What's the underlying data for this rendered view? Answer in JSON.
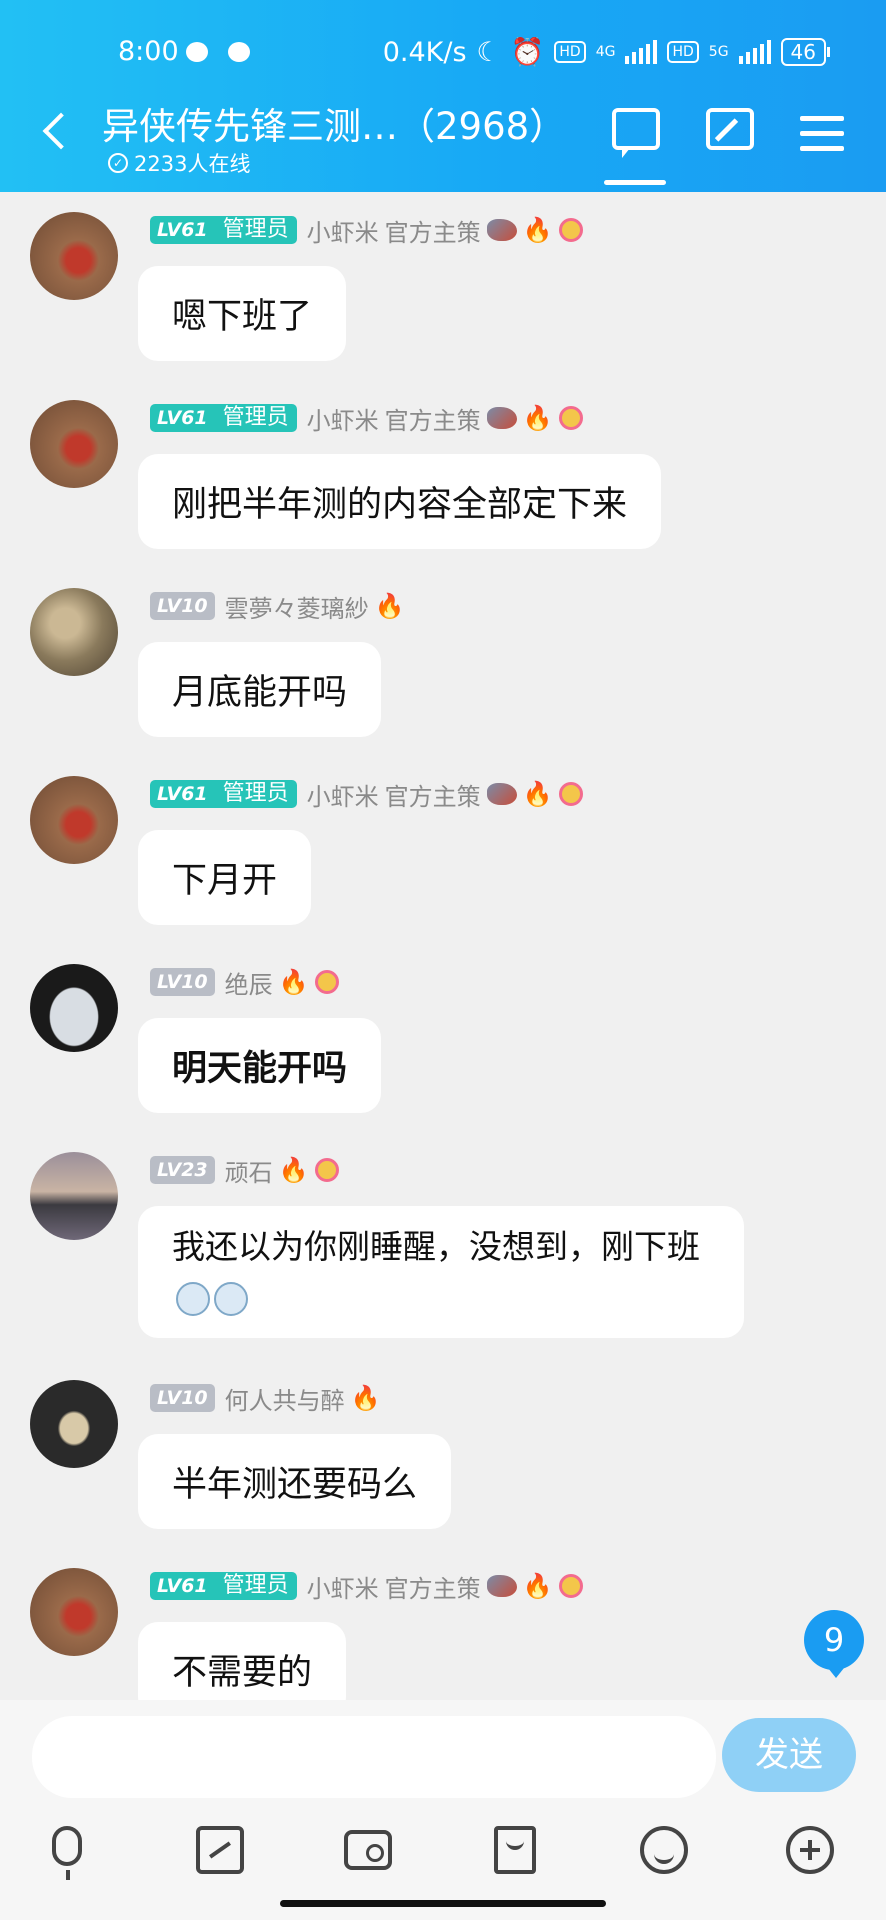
{
  "status_bar": {
    "time": "8:00",
    "speed": "0.4K/s",
    "hd1": "HD",
    "net1": "4G",
    "hd2": "HD",
    "net2": "5G",
    "battery": "46"
  },
  "header": {
    "title": "异侠传先锋三测…（2968）",
    "online": "2233人在线"
  },
  "messages": [
    {
      "level": "LV61",
      "role": "管理员",
      "name": "小虾米",
      "title": "官方主策",
      "text": "嗯下班了",
      "avatar_color": "#9a6a4a"
    },
    {
      "level": "LV61",
      "role": "管理员",
      "name": "小虾米",
      "title": "官方主策",
      "text": "刚把半年测的内容全部定下来",
      "avatar_color": "#9a6a4a"
    },
    {
      "level": "LV10",
      "name": "雲夢々菱璃紗",
      "text": "月底能开吗",
      "avatar_color": "#8a7a5c"
    },
    {
      "level": "LV61",
      "role": "管理员",
      "name": "小虾米",
      "title": "官方主策",
      "text": "下月开",
      "avatar_color": "#9a6a4a"
    },
    {
      "level": "LV10",
      "name": "绝辰",
      "text": "明天能开吗",
      "avatar_color": "#1a1a1a"
    },
    {
      "level": "LV23",
      "name": "顽石",
      "text": "我还以为你刚睡醒，没想到，刚下班",
      "avatar_color": "#6a6068"
    },
    {
      "level": "LV10",
      "name": "何人共与醉",
      "text": "半年测还要码么",
      "avatar_color": "#2a2a2a"
    },
    {
      "level": "LV61",
      "role": "管理员",
      "name": "小虾米",
      "title": "官方主策",
      "text": "不需要的",
      "avatar_color": "#9a6a4a"
    }
  ],
  "unread_count": "9",
  "composer": {
    "input_value": "",
    "send_label": "发送"
  },
  "colors": {
    "header": "#1aa9f5",
    "admin_tag": "#26c4b8",
    "member_tag": "#b9bdc6",
    "accent": "#1a9cf2"
  },
  "icons": [
    "back-icon",
    "chat-icon",
    "edit-icon",
    "menu-icon",
    "mic-icon",
    "image-icon",
    "camera-icon",
    "redpacket-icon",
    "emoji-icon",
    "plus-icon"
  ]
}
